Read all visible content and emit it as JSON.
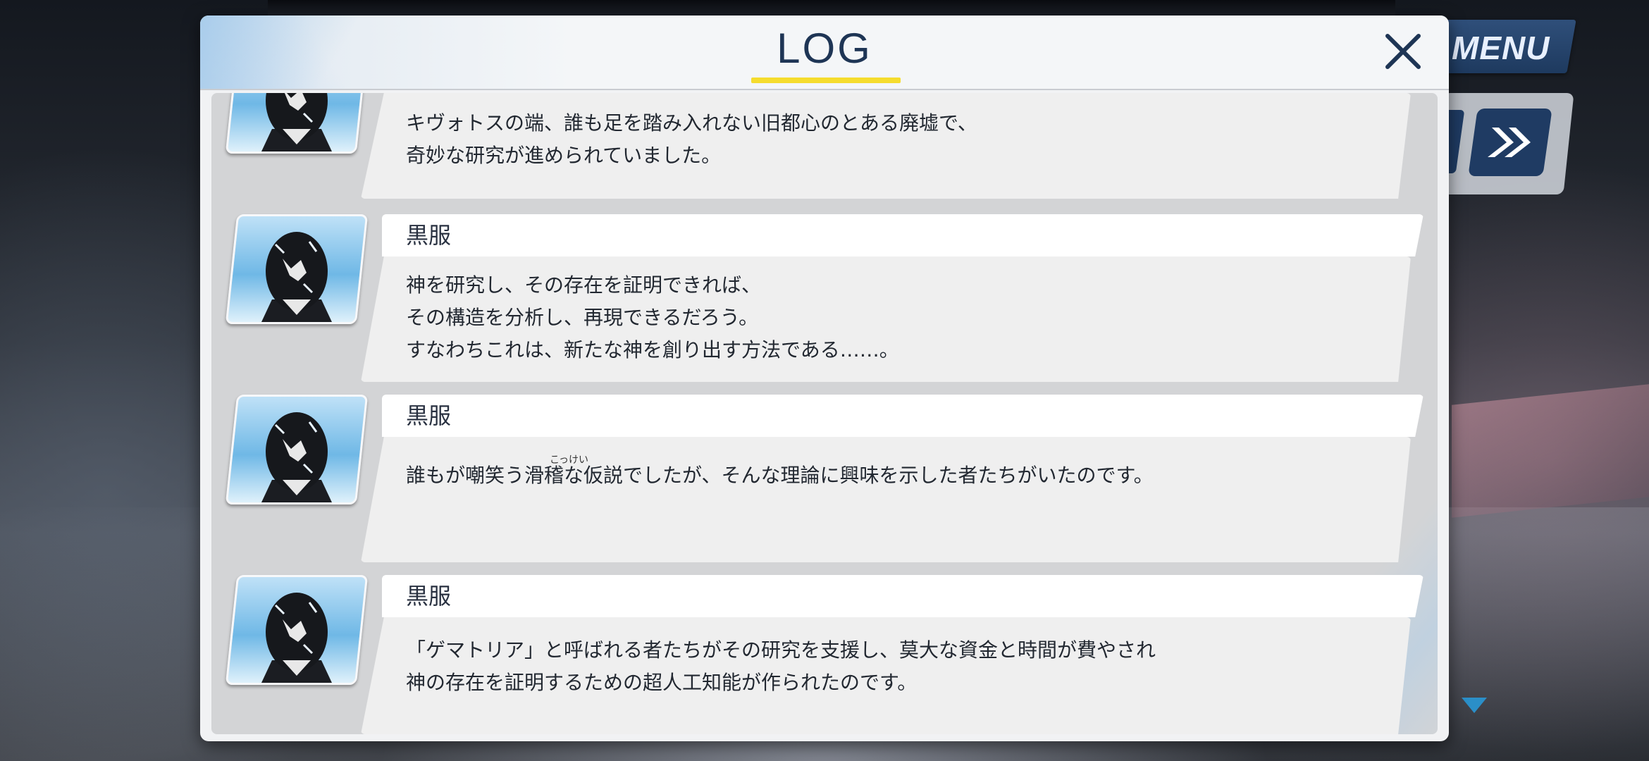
{
  "app": {
    "window_title": "LOG",
    "menu_label": "MENU",
    "close_icon": "close-icon",
    "fast_forward_icon": "fast-forward-icon"
  },
  "colors": {
    "title_text": "#1e3555",
    "title_underline": "#f5dc2e",
    "menu_bg": "#1e3a5f",
    "bubble_bg": "#efefef",
    "body_bg": "#d3d4d6"
  },
  "entries": [
    {
      "speaker": "",
      "lines": "キヴォトスの端、誰も足を踏み入れない旧都心のとある廃墟で、\n奇妙な研究が進められていました。"
    },
    {
      "speaker": "黒服",
      "lines": "神を研究し、その存在を証明できれば、\nその構造を分析し、再現できるだろう。\nすなわちこれは、新たな神を創り出す方法である……。"
    },
    {
      "speaker": "黒服",
      "lines": "誰もが嘲笑う滑稽な仮説でしたが、そんな理論に興味を示した者たちがいたのです。",
      "ruby": "こっけい"
    },
    {
      "speaker": "黒服",
      "lines": "「ゲマトリア」と呼ばれる者たちがその研究を支援し、莫大な資金と時間が費やされ\n神の存在を証明するための超人工知能が作られたのです。"
    }
  ]
}
